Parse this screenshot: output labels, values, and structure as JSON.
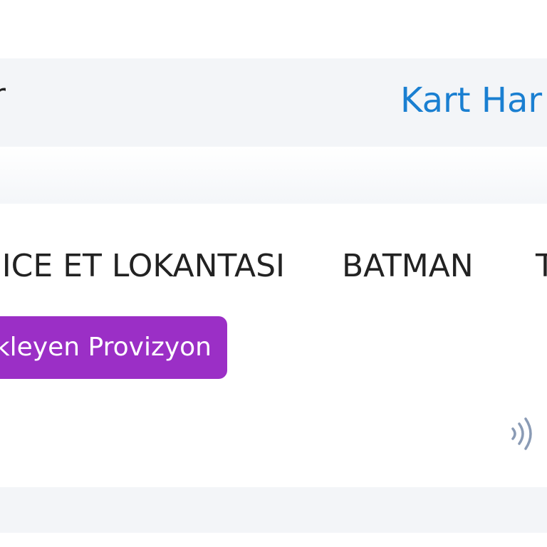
{
  "header": {
    "left_text": "r",
    "right_link": "Kart Har"
  },
  "transaction": {
    "merchant_name": "ICE ET LOKANTASI",
    "merchant_city": "BATMAN",
    "merchant_extra": "T",
    "status_badge": "kleyen Provizyon",
    "status_color": "#9b2fc6",
    "payment_icon": "contactless-icon"
  },
  "colors": {
    "accent": "#1a7fd1",
    "header_bg": "#f3f5f8"
  }
}
